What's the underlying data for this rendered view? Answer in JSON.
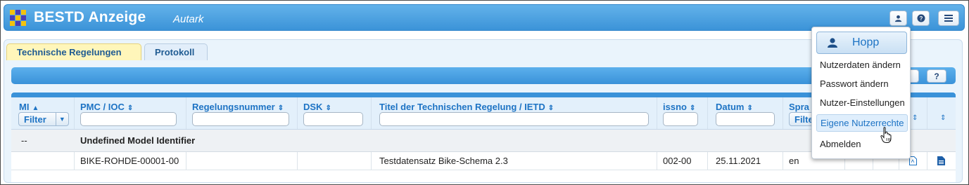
{
  "header": {
    "title": "BESTD Anzeige",
    "subtitle": "Autark",
    "buttons": [
      "user-icon",
      "help-icon",
      "menu-icon"
    ]
  },
  "tabs": [
    {
      "label": "Technische Regelungen",
      "active": true
    },
    {
      "label": "Protokoll",
      "active": false
    }
  ],
  "toolbar": {
    "help_label": "?"
  },
  "table": {
    "columns": [
      {
        "label": "MI",
        "sort": "▲",
        "filter_label": "Filter"
      },
      {
        "label": "PMC / IOC",
        "sort": "⇕"
      },
      {
        "label": "Regelungsnummer",
        "sort": "⇕"
      },
      {
        "label": "DSK",
        "sort": "⇕"
      },
      {
        "label": "Titel der Technischen Regelung / IETD",
        "sort": "⇕"
      },
      {
        "label": "issno",
        "sort": "⇕"
      },
      {
        "label": "Datum",
        "sort": "⇕"
      },
      {
        "label": "Spra",
        "sort": "",
        "filter_label": "Filte"
      }
    ],
    "group": {
      "mi": "--",
      "label": "Undefined Model Identifier"
    },
    "rows": [
      {
        "mi": "",
        "pmc": "BIKE-ROHDE-00001-00",
        "regelungsnummer": "",
        "dsk": "",
        "titel": "Testdatensatz Bike-Schema 2.3",
        "issno": "002-00",
        "datum": "25.11.2021",
        "sprache": "en"
      }
    ]
  },
  "user_menu": {
    "user_name": "Hopp",
    "items": [
      "Nutzerdaten ändern",
      "Passwort ändern",
      "Nutzer-Einstellungen",
      "Eigene Nutzerrechte",
      "Abmelden"
    ],
    "hovered_index": 3
  },
  "colors": {
    "header_blue": "#3b93d8",
    "accent_text": "#1d73c4",
    "active_tab": "#fff6ba"
  }
}
